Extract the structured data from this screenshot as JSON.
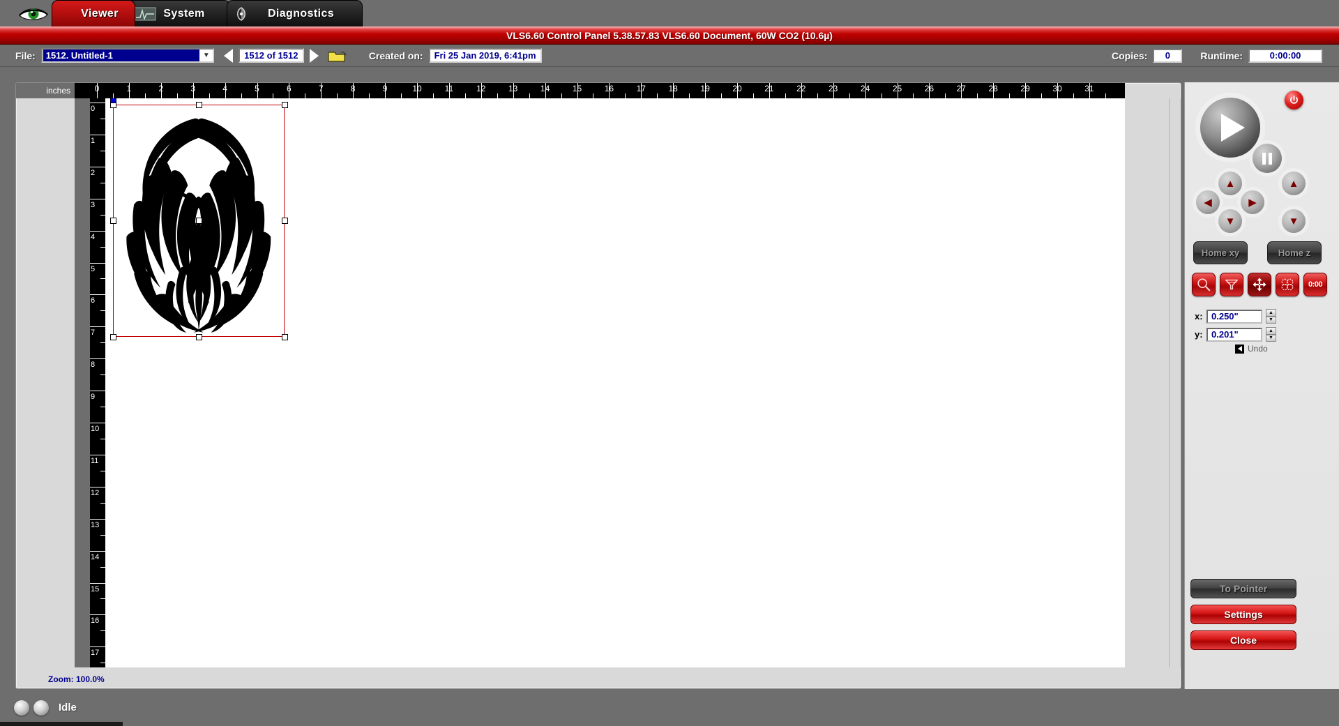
{
  "tabs": [
    {
      "id": "viewer",
      "label": "Viewer",
      "icon": "eye-icon",
      "active": true
    },
    {
      "id": "system",
      "label": "System",
      "icon": "waveform-icon",
      "active": false
    },
    {
      "id": "diagnostics",
      "label": "Diagnostics",
      "icon": "gauge-icon",
      "active": false
    }
  ],
  "titlebar": {
    "text": "VLS6.60  Control Panel   5.38.57.83     VLS6.60 Document, 60W CO2 (10.6µ)"
  },
  "toolbar": {
    "file_label": "File:",
    "file_value": "1512. Untitled-1",
    "prev_icon": "previous-arrow-icon",
    "next_icon": "next-arrow-icon",
    "page_counter": "1512 of 1512",
    "open_icon": "open-folder-icon",
    "created_label": "Created on:",
    "created_value": "Fri 25 Jan 2019,  6:41pm",
    "copies_label": "Copies:",
    "copies_value": "0",
    "runtime_label": "Runtime:",
    "runtime_value": "0:00:00"
  },
  "workspace": {
    "units_label": "inches",
    "zoom_label": "Zoom:  100.0%",
    "h_ruler_max": 31,
    "v_ruler_max": 17,
    "selection": {
      "x_in": 0.25,
      "y_in": 0.201,
      "width_in": 5.35,
      "height_in": 7.25
    },
    "artwork": "tribal-phoenix-graphic"
  },
  "controls": {
    "play_icon": "play-icon",
    "pause_icon": "pause-icon",
    "power_icon": "power-icon",
    "dpad": {
      "up_icon": "arrow-up-icon",
      "down_icon": "arrow-down-icon",
      "left_icon": "arrow-left-icon",
      "right_icon": "arrow-right-icon"
    },
    "zpad": {
      "up_icon": "z-up-icon",
      "down_icon": "z-down-icon"
    },
    "home_xy": "Home xy",
    "home_z": "Home z",
    "tools": [
      {
        "name": "zoom-tool",
        "icon": "magnifier-icon",
        "active": false
      },
      {
        "name": "focus-tool",
        "icon": "focus-cone-icon",
        "active": false
      },
      {
        "name": "move-tool",
        "icon": "move-arrows-icon",
        "active": true
      },
      {
        "name": "duplicate-tool",
        "icon": "duplicate-icon",
        "active": false
      },
      {
        "name": "estimate-tool",
        "icon": "timer-icon",
        "label": "0:00",
        "active": false
      }
    ],
    "x_label": "x:",
    "x_value": "0.250\"",
    "y_label": "y:",
    "y_value": "0.201\"",
    "undo_label": "Undo",
    "to_pointer": "To Pointer",
    "settings": "Settings",
    "close": "Close"
  },
  "statusbar": {
    "state": "Idle"
  },
  "colors": {
    "brand_red": "#c00000",
    "panel_gray": "#6e6e6e",
    "selection_red": "#c00000",
    "field_blue": "#00008f",
    "anchor_blue": "#0000d0"
  }
}
